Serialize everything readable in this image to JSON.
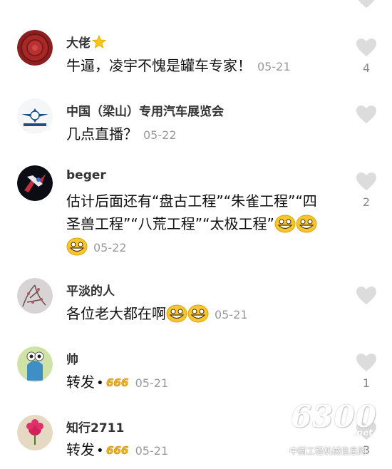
{
  "comments": [
    {
      "username": "大佬",
      "text": "牛逼，凌宇不愧是罐车专家！",
      "date": "05-21",
      "likes": "4"
    },
    {
      "username": "中国（梁山）专用汽车展览会",
      "text": "几点直播？",
      "date": "05-22",
      "likes": ""
    },
    {
      "username": "beger",
      "text_line1": "估计后面还有“盘古工程”“朱雀工程”“四",
      "text_line2": "圣兽工程”“八荒工程”“太极工程”",
      "date": "05-22",
      "likes": "2"
    },
    {
      "username": "平淡的人",
      "text": "各位老大都在啊",
      "date": "05-21",
      "likes": ""
    },
    {
      "username": "帅",
      "text": "转发",
      "date": "05-21",
      "likes": "1"
    },
    {
      "username": "知行2711",
      "text": "转发",
      "date": "05-21",
      "likes": "3"
    }
  ],
  "watermark": {
    "logo": "6300",
    "suffix": ".net",
    "subtitle": "中国工程机械信息网"
  },
  "icons": [
    "star-icon",
    "heart-icon",
    "grin-emoji-icon",
    "666-badge-icon"
  ],
  "colors": {
    "username": "#333333",
    "text": "#111111",
    "date": "#999999",
    "heart": "#dcdcdc",
    "emoji": "#f6c631"
  }
}
